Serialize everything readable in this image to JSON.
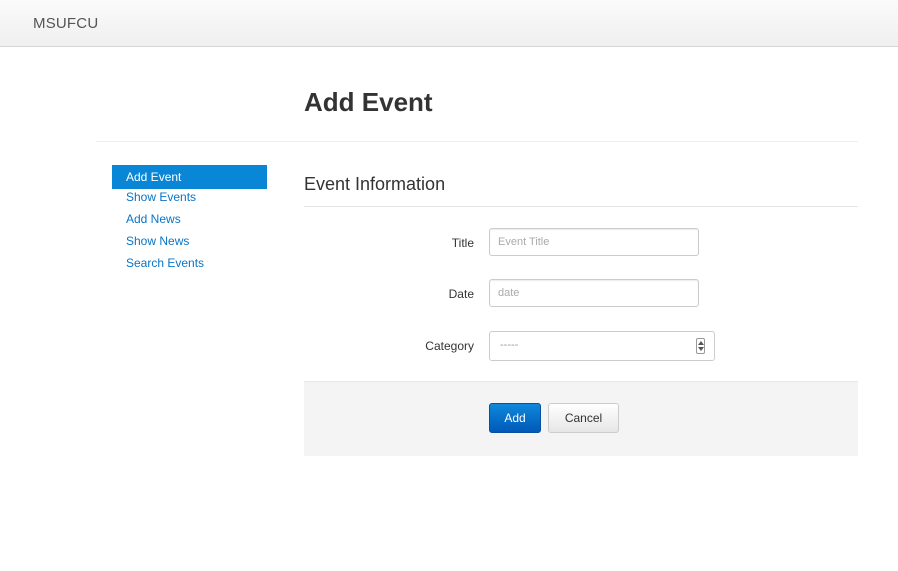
{
  "navbar": {
    "brand": "MSUFCU"
  },
  "page": {
    "title": "Add Event"
  },
  "sidebar": {
    "items": [
      {
        "label": "Add Event",
        "active": true
      },
      {
        "label": "Show Events",
        "active": false
      },
      {
        "label": "Add News",
        "active": false
      },
      {
        "label": "Show News",
        "active": false
      },
      {
        "label": "Search Events",
        "active": false
      }
    ]
  },
  "form": {
    "legend": "Event Information",
    "title": {
      "label": "Title",
      "placeholder": "Event Title",
      "value": ""
    },
    "date": {
      "label": "Date",
      "placeholder": "date",
      "value": ""
    },
    "category": {
      "label": "Category",
      "selected": "-----"
    },
    "add_label": "Add",
    "cancel_label": "Cancel"
  },
  "colors": {
    "accent": "#0a86d6",
    "link": "#0a74c5",
    "primary_button": "#0059b8"
  },
  "icons": {
    "select_arrow": "up-down-arrows-icon"
  }
}
